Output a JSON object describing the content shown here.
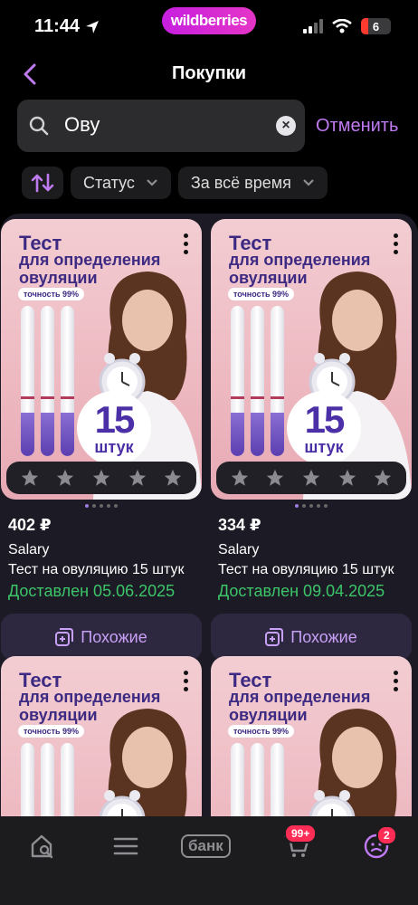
{
  "status_bar": {
    "time": "11:44",
    "brand_pill": "wildberries",
    "battery": "6"
  },
  "header": {
    "title": "Покупки"
  },
  "search": {
    "value": "Ову",
    "cancel_label": "Отменить"
  },
  "filters": {
    "status_label": "Статус",
    "period_label": "За всё время"
  },
  "product_image": {
    "title_line1": "Тест",
    "title_line2": "для определения",
    "title_line3": "овуляции",
    "accuracy": "точность 99%",
    "count_number": "15",
    "count_unit": "штук"
  },
  "cards": [
    {
      "price": "402 ₽",
      "brand": "Salary",
      "name": "Тест на овуляцию 15 штук",
      "delivered": "Доставлен 05.06.2025",
      "similar_label": "Похожие",
      "rating_stars": 5
    },
    {
      "price": "334 ₽",
      "brand": "Salary",
      "name": "Тест на овуляцию 15 штук",
      "delivered": "Доставлен 09.04.2025",
      "similar_label": "Похожие",
      "rating_stars": 5
    }
  ],
  "tabbar": {
    "bank_label": "банк",
    "cart_count": "99+",
    "profile_count": "2"
  },
  "colors": {
    "accent": "#c07af2",
    "delivered": "#3cc569",
    "badge": "#ff2d55",
    "brand": "#cb2ee0"
  },
  "icons": [
    "location-arrow-icon",
    "signal-icon",
    "wifi-icon",
    "battery-icon",
    "back-chevron-icon",
    "search-icon",
    "clear-icon",
    "sort-icon",
    "chevron-down-icon",
    "more-dots-icon",
    "star-icon",
    "similar-icon",
    "home-search-icon",
    "menu-icon",
    "cart-icon",
    "profile-icon"
  ]
}
